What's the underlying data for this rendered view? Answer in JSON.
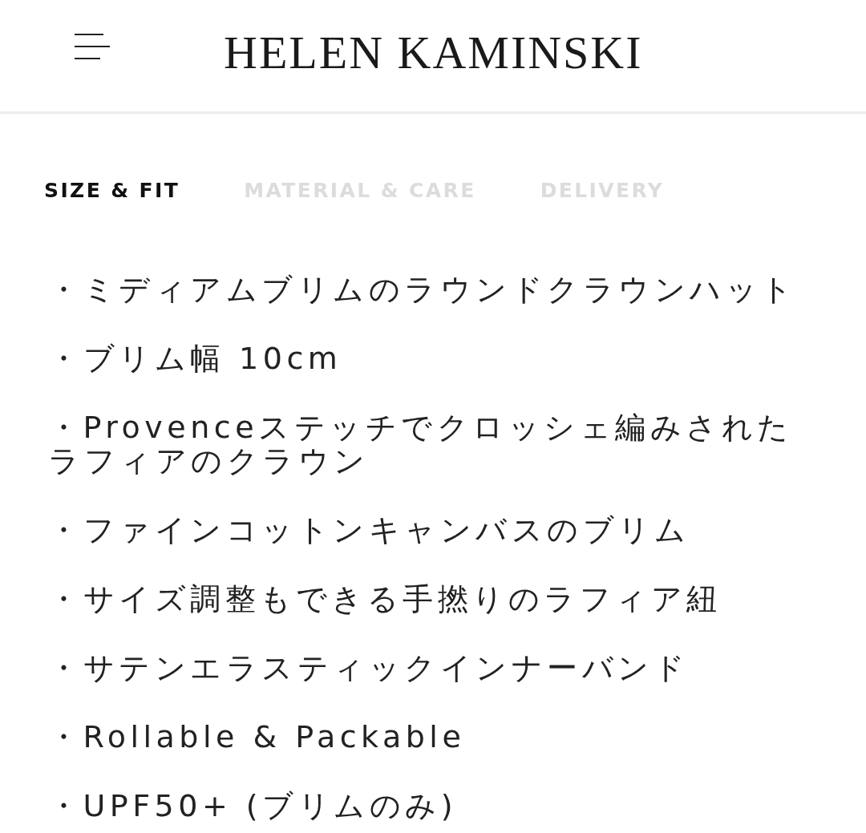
{
  "header": {
    "logo": "HELEN KAMINSKI"
  },
  "tabs": [
    {
      "label": "SIZE & FIT",
      "selected": true
    },
    {
      "label": "MATERIAL & CARE",
      "selected": false
    },
    {
      "label": "DELIVERY",
      "selected": false
    }
  ],
  "details": [
    "・ミディアムブリムのラウンドクラウンハット",
    "・ブリム幅 10cm",
    "・Provenceステッチでクロッシェ編みされたラフィアのクラウン",
    "・ファインコットンキャンバスのブリム",
    "・サイズ調整もできる手撚りのラフィア紐",
    "・サテンエラスティックインナーバンド",
    "・Rollable & Packable",
    "・UPF50+ (ブリムのみ)"
  ]
}
